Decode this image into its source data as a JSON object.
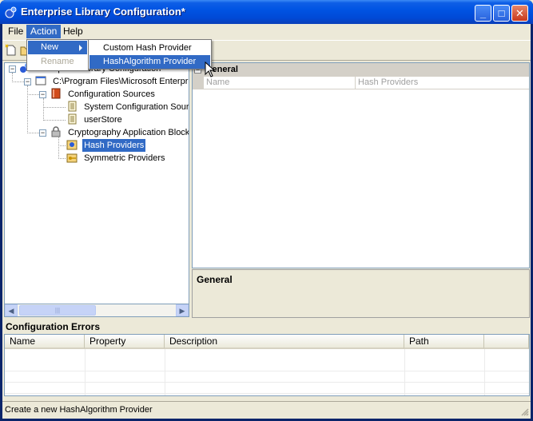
{
  "window": {
    "title": "Enterprise Library Configuration*",
    "controls": {
      "minimize": "_",
      "maximize": "□",
      "close": "✕"
    }
  },
  "menu": {
    "items": [
      {
        "label": "File"
      },
      {
        "label": "Action"
      },
      {
        "label": "Help"
      }
    ],
    "action_menu": {
      "items": [
        {
          "label": "New",
          "has_submenu": true
        },
        {
          "label": "Rename",
          "disabled": true
        }
      ]
    },
    "new_submenu": {
      "items": [
        {
          "label": "Custom Hash Provider"
        },
        {
          "label": "HashAlgorithm Provider"
        }
      ]
    }
  },
  "tree": {
    "nodes": [
      {
        "label": "Enterprise Library Configuration",
        "icon": "enterprise-library-icon"
      },
      {
        "label": "C:\\Program Files\\Microsoft Enterpris",
        "icon": "application-icon"
      },
      {
        "label": "Configuration Sources",
        "icon": "book-icon"
      },
      {
        "label": "System Configuration Source",
        "icon": "document-icon"
      },
      {
        "label": "userStore",
        "icon": "document-icon"
      },
      {
        "label": "Cryptography Application Block",
        "icon": "lock-icon"
      },
      {
        "label": "Hash Providers",
        "icon": "hash-providers-icon"
      },
      {
        "label": "Symmetric Providers",
        "icon": "key-folder-icon"
      }
    ],
    "selected": "Hash Providers"
  },
  "property_grid": {
    "category": "General",
    "columns": {
      "name": "Name",
      "value": "Hash Providers"
    }
  },
  "description": {
    "title": "General"
  },
  "errors": {
    "label": "Configuration Errors",
    "columns": [
      "Name",
      "Property",
      "Description",
      "Path"
    ]
  },
  "status": {
    "text": "Create a new HashAlgorithm Provider"
  },
  "colors": {
    "selection": "#316ac5",
    "titlebar": "#0054e3",
    "face": "#ece9d8"
  }
}
